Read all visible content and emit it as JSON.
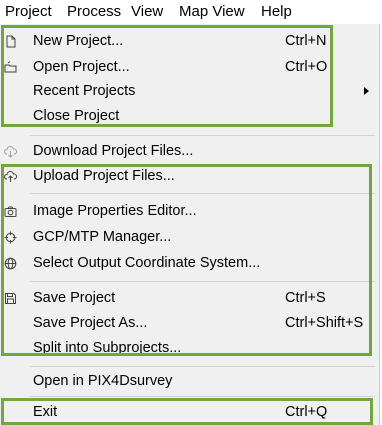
{
  "menubar": {
    "items": [
      "Project",
      "Process",
      "View",
      "Map View",
      "Help"
    ]
  },
  "menu": {
    "new_project": {
      "label": "New Project...",
      "shortcut": "Ctrl+N",
      "icon": "new-file-icon"
    },
    "open_project": {
      "label": "Open Project...",
      "shortcut": "Ctrl+O",
      "icon": "open-folder-icon"
    },
    "recent_projects": {
      "label": "Recent Projects"
    },
    "close_project": {
      "label": "Close Project"
    },
    "download_files": {
      "label": "Download Project Files...",
      "icon": "cloud-download-icon",
      "disabled": true
    },
    "upload_files": {
      "label": "Upload Project Files...",
      "icon": "cloud-upload-icon"
    },
    "image_props": {
      "label": "Image Properties Editor...",
      "icon": "camera-icon"
    },
    "gcp_manager": {
      "label": "GCP/MTP Manager...",
      "icon": "crosshair-icon"
    },
    "output_coord": {
      "label": "Select Output Coordinate System...",
      "icon": "globe-icon"
    },
    "save_project": {
      "label": "Save Project",
      "shortcut": "Ctrl+S",
      "icon": "save-icon"
    },
    "save_as": {
      "label": "Save Project As...",
      "shortcut": "Ctrl+Shift+S"
    },
    "split": {
      "label": "Split into Subprojects..."
    },
    "open_pix4d": {
      "label": "Open in PIX4Dsurvey",
      "disabled": true
    },
    "exit": {
      "label": "Exit",
      "shortcut": "Ctrl+Q"
    }
  },
  "colors": {
    "highlight_border": "#70a83b",
    "menu_background": "#f0f0f0",
    "disabled_text": "#8c8c8c"
  }
}
